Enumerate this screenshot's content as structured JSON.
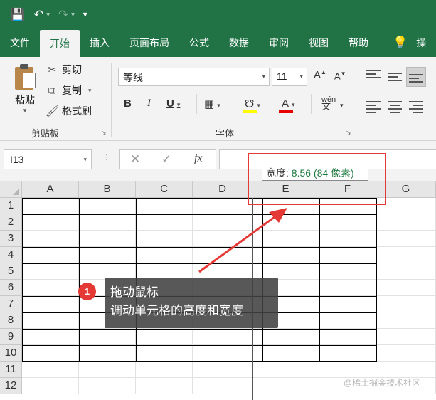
{
  "qat": {
    "save_icon": "save-icon",
    "undo_icon": "undo-icon",
    "redo_icon": "redo-icon",
    "customize_icon": "customize-icon"
  },
  "tabs": [
    "文件",
    "开始",
    "插入",
    "页面布局",
    "公式",
    "数据",
    "审阅",
    "视图",
    "帮助"
  ],
  "tell_me_icon": "lightbulb-icon",
  "tab_cut_off": "操",
  "clipboard": {
    "paste_label": "粘贴",
    "cut_label": "剪切",
    "copy_label": "复制",
    "format_painter_label": "格式刷",
    "group_label": "剪贴板"
  },
  "font": {
    "name": "等线",
    "size": "11",
    "grow_label": "A",
    "shrink_label": "A",
    "bold": "B",
    "italic": "I",
    "underline": "U",
    "group_label": "字体",
    "phonetic_top": "wén",
    "phonetic_bottom": "文",
    "fill_color": "#ffff00",
    "font_color": "#e60000"
  },
  "formula_bar": {
    "name_box": "I13",
    "cancel": "✕",
    "enter": "✓",
    "fx": "fx",
    "content": ""
  },
  "columns": [
    "A",
    "B",
    "C",
    "D",
    "E",
    "F",
    "G"
  ],
  "rows": [
    "1",
    "2",
    "3",
    "4",
    "5",
    "6",
    "7",
    "8",
    "9",
    "10",
    "11",
    "12"
  ],
  "tooltip": {
    "prefix": "宽度: ",
    "value": "8.56 (84 像素)"
  },
  "callout": {
    "badge": "1",
    "line1": "拖动鼠标",
    "line2": "调动单元格的高度和宽度"
  },
  "watermark": "@稀土掘金技术社区",
  "colors": {
    "excel_green": "#217346",
    "annotation_red": "#e53935",
    "tooltip_value": "#1d7a3e"
  }
}
